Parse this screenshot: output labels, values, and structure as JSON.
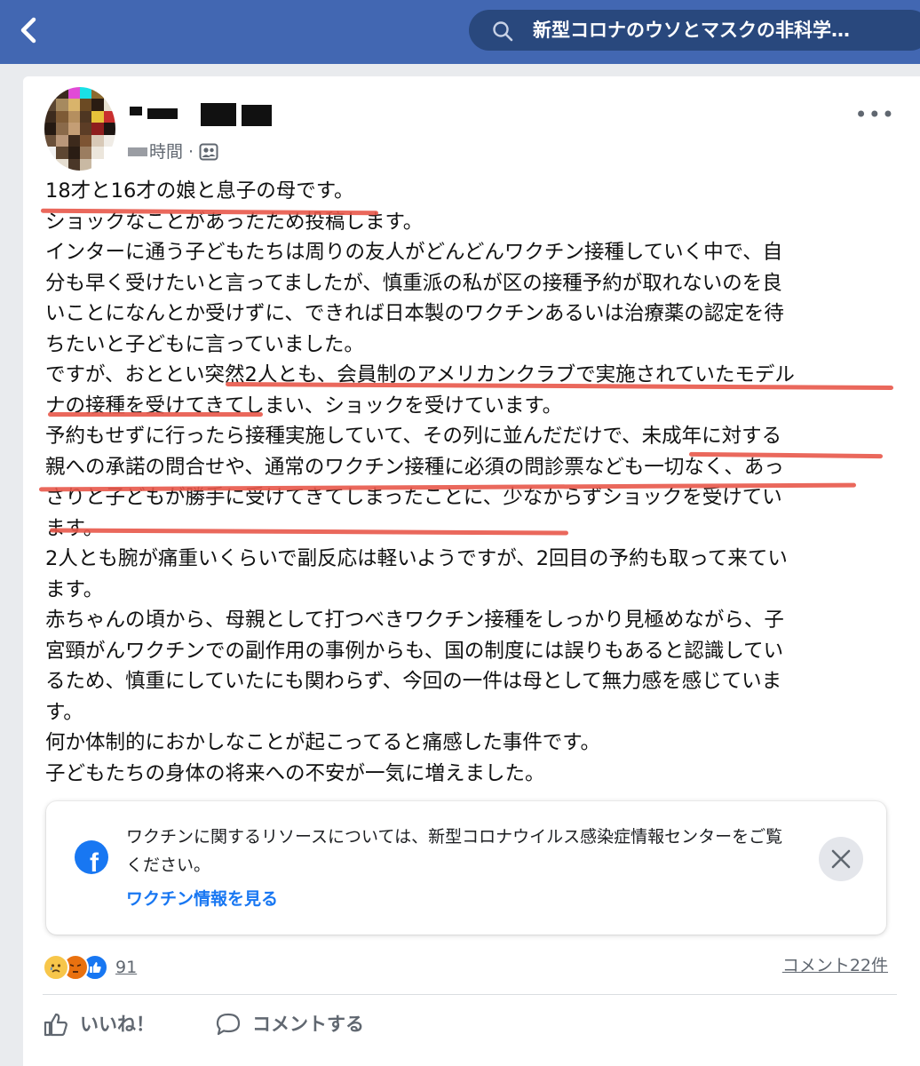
{
  "search": {
    "query": "新型コロナのウソとマスクの非科学…"
  },
  "post": {
    "time": "時間",
    "lines": [
      "18才と16才の娘と息子の母です。",
      "ショックなことがあったため投稿します。",
      "インターに通う子どもたちは周りの友人がどんどんワクチン接種していく中で、自",
      "分も早く受けたいと言ってましたが、慎重派の私が区の接種予約が取れないのを良",
      "いことになんとか受けずに、できれば日本製のワクチンあるいは治療薬の認定を待",
      "ちたいと子どもに言っていました。",
      "ですが、おととい突然2人とも、会員制のアメリカンクラブで実施されていたモデル",
      "ナの接種を受けてきてしまい、ショックを受けています。",
      "予約もせずに行ったら接種実施していて、その列に並んだだけで、未成年に対する",
      "親への承諾の問合せや、通常のワクチン接種に必須の問診票なども一切なく、あっ",
      "さりと子どもが勝手に受けてきてしまったことに、少なからずショックを受けてい",
      "ます。",
      "2人とも腕が痛重いくらいで副反応は軽いようですが、2回目の予約も取って来てい",
      "ます。",
      "赤ちゃんの頃から、母親として打つべきワクチン接種をしっかり見極めながら、子",
      "宮頸がんワクチンでの副作用の事例からも、国の制度には誤りもあると認識してい",
      "るため、慎重にしていたにも関わらず、今回の一件は母として無力感を感じていま",
      "す。",
      "何か体制的におかしなことが起こってると痛感した事件です。",
      "子どもたちの身体の将来への不安が一気に増えました。"
    ]
  },
  "notice": {
    "text": "ワクチンに関するリソースについては、新型コロナウイルス感染症情報センターをご覧ください。",
    "link": "ワクチン情報を見る"
  },
  "stats": {
    "reaction_count": "91",
    "comment_count": "コメント22件"
  },
  "actions": {
    "like": "いいね！",
    "comment": "コメントする"
  },
  "colors": {
    "header": "#4267b2",
    "link": "#1877f2",
    "annotation": "#e8584a"
  }
}
